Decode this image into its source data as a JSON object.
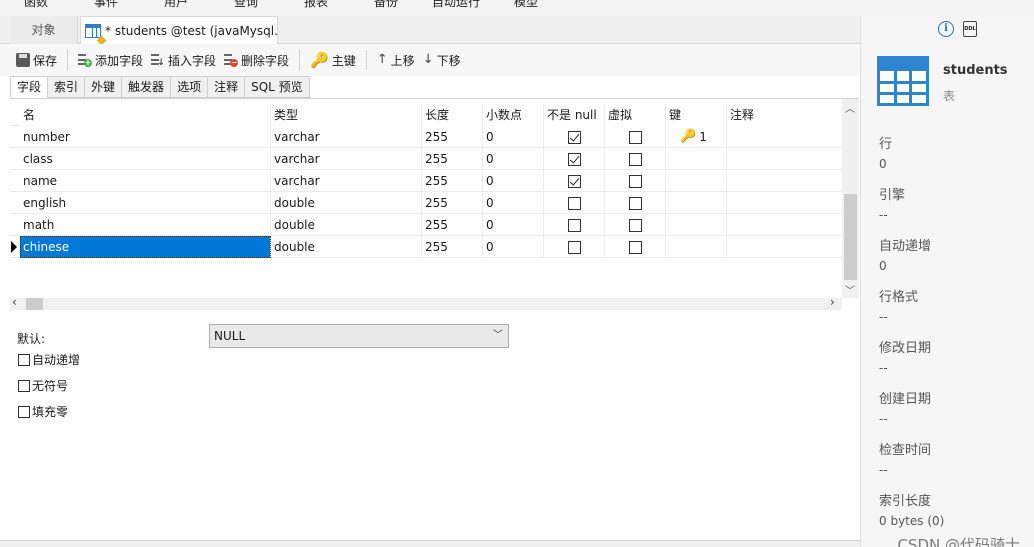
{
  "menu": [
    "函数",
    "事件",
    "用户",
    "查询",
    "报表",
    "备份",
    "自动运行",
    "模型"
  ],
  "tabs": {
    "objects": "对象",
    "editor": "* students @test (javaMysql..."
  },
  "toolbar": {
    "save": "保存",
    "add_field": "添加字段",
    "insert_field": "插入字段",
    "delete_field": "删除字段",
    "primary_key": "主键",
    "move_up": "上移",
    "move_down": "下移"
  },
  "subtabs": [
    "字段",
    "索引",
    "外键",
    "触发器",
    "选项",
    "注释",
    "SQL 预览"
  ],
  "grid": {
    "columns": [
      "名",
      "类型",
      "长度",
      "小数点",
      "不是 null",
      "虚拟",
      "键",
      "注释"
    ],
    "rows": [
      {
        "name": "number",
        "type": "varchar",
        "length": "255",
        "decimals": "0",
        "not_null": true,
        "virtual": false,
        "key": "1"
      },
      {
        "name": "class",
        "type": "varchar",
        "length": "255",
        "decimals": "0",
        "not_null": true,
        "virtual": false,
        "key": ""
      },
      {
        "name": "name",
        "type": "varchar",
        "length": "255",
        "decimals": "0",
        "not_null": true,
        "virtual": false,
        "key": ""
      },
      {
        "name": "english",
        "type": "double",
        "length": "255",
        "decimals": "0",
        "not_null": false,
        "virtual": false,
        "key": ""
      },
      {
        "name": "math",
        "type": "double",
        "length": "255",
        "decimals": "0",
        "not_null": false,
        "virtual": false,
        "key": ""
      },
      {
        "name": "chinese",
        "type": "double",
        "length": "255",
        "decimals": "0",
        "not_null": false,
        "virtual": false,
        "key": ""
      }
    ],
    "selected_row": 5
  },
  "props": {
    "default_label": "默认:",
    "default_value": "NULL",
    "options": [
      {
        "label": "自动递增",
        "checked": false
      },
      {
        "label": "无符号",
        "checked": false
      },
      {
        "label": "填充零",
        "checked": false
      }
    ]
  },
  "info": {
    "ddl_icon_text": "DDL",
    "object_name": "students",
    "object_type": "表",
    "items": [
      {
        "label": "行",
        "value": "0"
      },
      {
        "label": "引擎",
        "value": "--"
      },
      {
        "label": "自动递增",
        "value": "0"
      },
      {
        "label": "行格式",
        "value": "--"
      },
      {
        "label": "修改日期",
        "value": "--"
      },
      {
        "label": "创建日期",
        "value": "--"
      },
      {
        "label": "检查时间",
        "value": "--"
      },
      {
        "label": "索引长度",
        "value": "0 bytes (0)"
      }
    ]
  },
  "watermark": "CSDN @代码骑士",
  "colors": {
    "selection": "#0078d7",
    "key_icon": "#e5a11b",
    "table_icon": "#2f84cf"
  }
}
